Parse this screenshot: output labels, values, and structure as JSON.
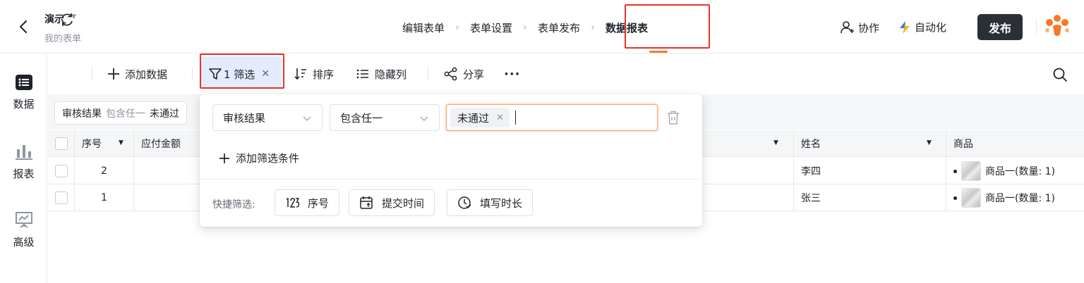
{
  "header": {
    "app_title": "演示",
    "app_subtitle": "我的表单",
    "steps": [
      "编辑表单",
      "表单设置",
      "表单发布",
      "数据报表"
    ],
    "collab_label": "协作",
    "automation_label": "自动化",
    "publish_label": "发布",
    "accent_color": "#f57e2c"
  },
  "rail": {
    "items": [
      {
        "label": "数据",
        "icon": "list-icon"
      },
      {
        "label": "报表",
        "icon": "bar-chart-icon"
      },
      {
        "label": "高级",
        "icon": "presentation-icon"
      }
    ]
  },
  "toolbar": {
    "add_label": "添加数据",
    "filter_label": "1 筛选",
    "sort_label": "排序",
    "hide_label": "隐藏列",
    "share_label": "分享"
  },
  "summary": {
    "field": "审核结果",
    "operator": "包含任一",
    "value": "未通过"
  },
  "table": {
    "headers": {
      "seq": "序号",
      "amount": "应付金额",
      "name": "姓名",
      "goods": "商品"
    },
    "rows": [
      {
        "seq": "2",
        "name": "李四",
        "goods": "商品一(数量: 1)"
      },
      {
        "seq": "1",
        "name": "张三",
        "goods": "商品一(数量: 1)"
      }
    ]
  },
  "filter_popover": {
    "field": "审核结果",
    "operator": "包含任一",
    "tag": "未通过",
    "add_condition": "添加筛选条件",
    "quick_label": "快捷筛选:",
    "quick_buttons": [
      "序号",
      "提交时间",
      "填写时长"
    ]
  }
}
